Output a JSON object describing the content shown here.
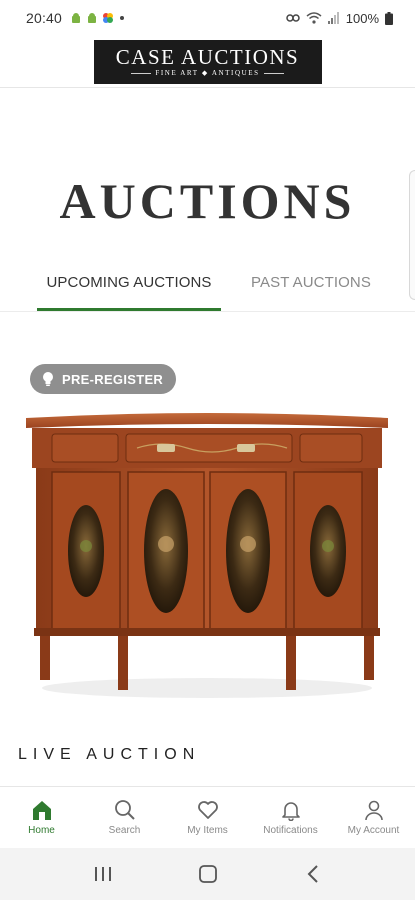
{
  "status_bar": {
    "time": "20:40",
    "battery": "100%",
    "icons": [
      "android-icon",
      "android-icon",
      "photos-icon",
      "dot-icon",
      "link-icon",
      "wifi-icon",
      "signal-icon",
      "battery-icon"
    ]
  },
  "header": {
    "logo_main": "CASE AUCTIONS",
    "logo_sub": "FINE ART ◆ ANTIQUES"
  },
  "page": {
    "title": "AUCTIONS"
  },
  "tabs": [
    {
      "label": "UPCOMING AUCTIONS",
      "active": true
    },
    {
      "label": "PAST AUCTIONS",
      "active": false
    }
  ],
  "auction": {
    "badge": "PRE-REGISTER",
    "image_alt": "Painted satinwood demilune sideboard cabinet",
    "type_label": "LIVE AUCTION"
  },
  "bottom_nav": [
    {
      "label": "Home",
      "icon": "home-icon",
      "active": true
    },
    {
      "label": "Search",
      "icon": "search-icon",
      "active": false
    },
    {
      "label": "My Items",
      "icon": "heart-icon",
      "active": false
    },
    {
      "label": "Notifications",
      "icon": "bell-icon",
      "active": false
    },
    {
      "label": "My Account",
      "icon": "person-icon",
      "active": false
    }
  ],
  "colors": {
    "accent": "#2f7a2f",
    "badge_bg": "#8f8f8f",
    "logo_bg": "#1b1b1b",
    "inactive_text": "#8a8a8a"
  }
}
